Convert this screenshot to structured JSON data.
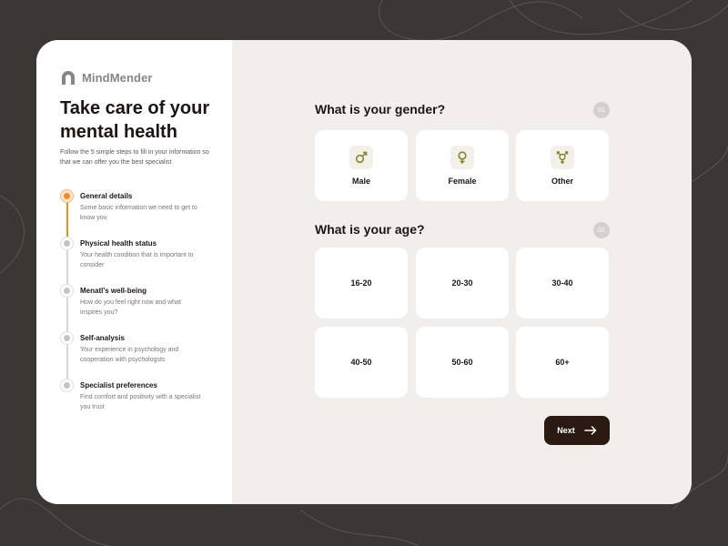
{
  "brand": {
    "name": "MindMender",
    "logo_icon": "arch-logo-icon",
    "logo_color": "#8b8480"
  },
  "intro": {
    "title": "Take care of your mental health",
    "subtitle": "Follow the 5 simple steps to fill in your information so that we can offer you the best specialist"
  },
  "steps": [
    {
      "title": "General details",
      "desc": "Some basic information we need to get to know you",
      "active": true
    },
    {
      "title": "Physical health status",
      "desc": "Your health condition that is important to consider",
      "active": false
    },
    {
      "title": "Menatl's well-being",
      "desc": "How do you feel right now and what inspires you?",
      "active": false
    },
    {
      "title": "Self-analysis",
      "desc": "Your experience in psychology and cooperation with psychologsts",
      "active": false
    },
    {
      "title": "Specialist preferences",
      "desc": "Find comfort and positivity with a specialist you trust",
      "active": false
    }
  ],
  "gender": {
    "question": "What is your gender?",
    "number": "01",
    "options": [
      {
        "label": "Male",
        "icon": "male-icon"
      },
      {
        "label": "Female",
        "icon": "female-icon"
      },
      {
        "label": "Other",
        "icon": "transgender-icon"
      }
    ]
  },
  "age": {
    "question": "What is your age?",
    "number": "02",
    "options": [
      "16-20",
      "20-30",
      "30-40",
      "40-50",
      "50-60",
      "60+"
    ]
  },
  "next_button": {
    "label": "Next",
    "icon": "arrow-right-icon"
  },
  "colors": {
    "accent": "#f08a2b",
    "dark": "#2a1a12",
    "gender_icon": "#7e8a2e",
    "background": "#3a3735",
    "panel": "#f2eeec"
  }
}
